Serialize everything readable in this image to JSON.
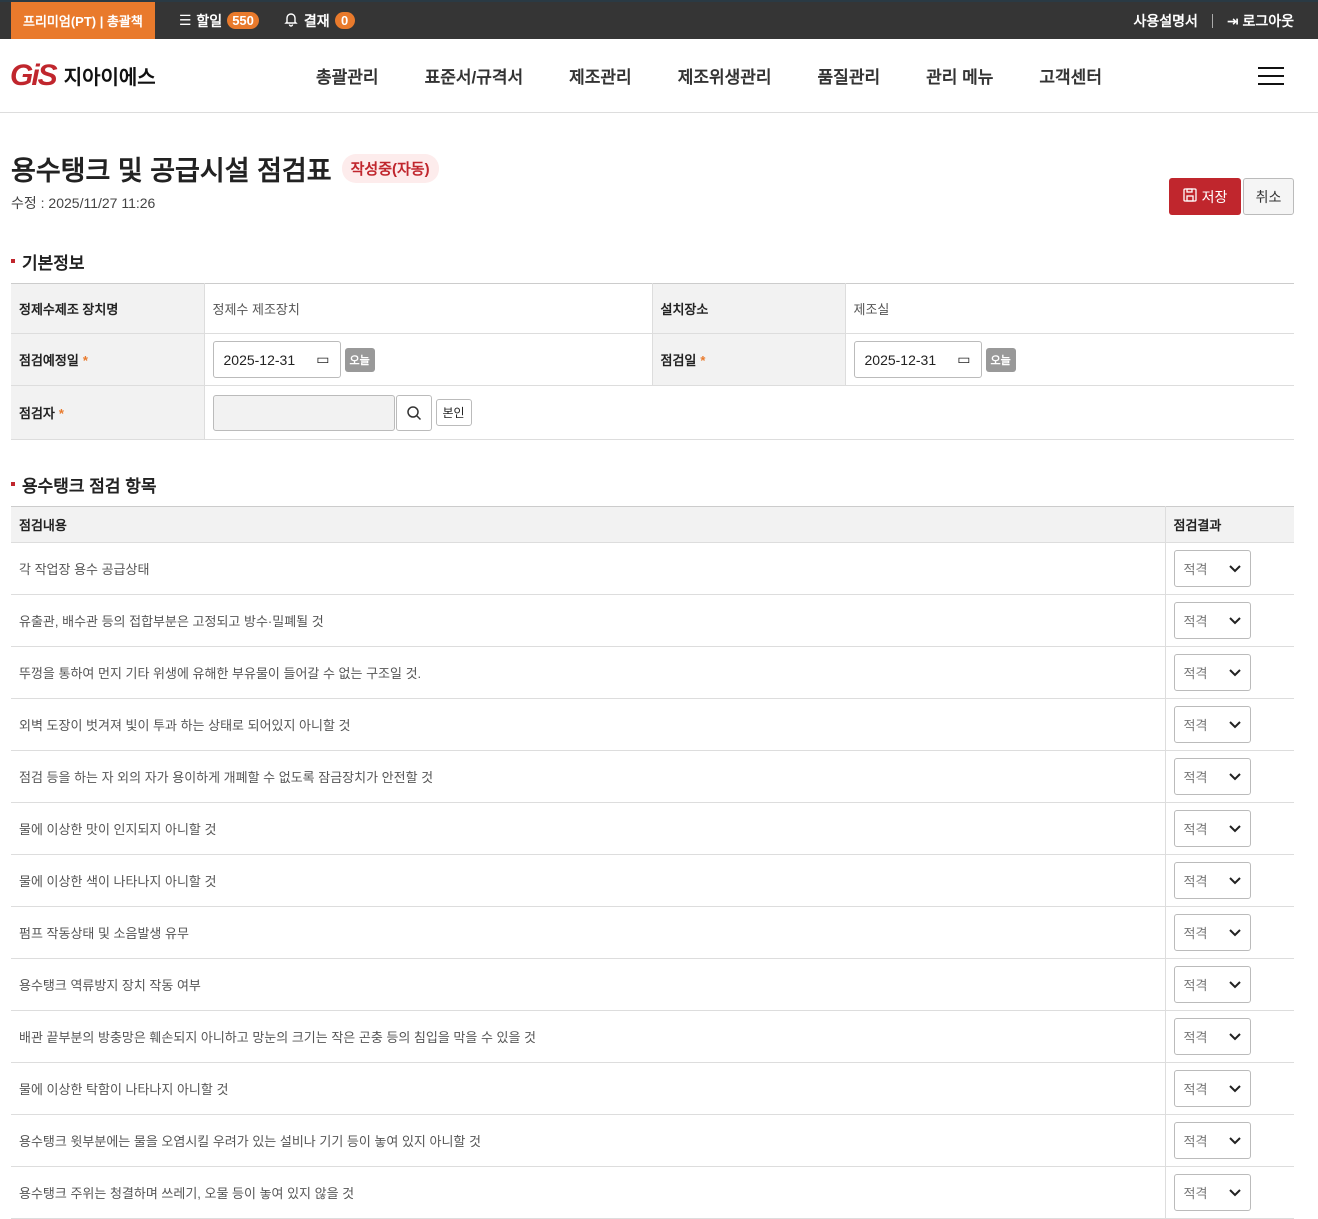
{
  "topbar": {
    "plan": "프리미엄(PT) | 총괄책",
    "todo_label": "할일",
    "todo_count": "550",
    "approval_label": "결재",
    "approval_count": "0",
    "manual": "사용설명서",
    "logout": "로그아웃"
  },
  "header": {
    "logo_mark": "GiS",
    "logo_text": "지아이에스",
    "nav": [
      "총괄관리",
      "표준서/규격서",
      "제조관리",
      "제조위생관리",
      "품질관리",
      "관리 메뉴",
      "고객센터"
    ]
  },
  "page": {
    "title": "용수탱크 및 공급시설 점검표",
    "status": "작성중(자동)",
    "modified": "수정 : 2025/11/27 11:26",
    "save": "저장",
    "cancel": "취소"
  },
  "basic": {
    "section": "기본정보",
    "device_label": "정제수제조 장치명",
    "device_value": "정제수 제조장치",
    "location_label": "설치장소",
    "location_value": "제조실",
    "planned_label": "점검예정일",
    "planned_date": "2025-12-31",
    "date_label": "점검일",
    "date_value": "2025-12-31",
    "today": "오늘",
    "inspector_label": "점검자",
    "inspector_value": "",
    "self": "본인",
    "required": "*"
  },
  "items": {
    "section": "용수탱크 점검 항목",
    "col_content": "점검내용",
    "col_result": "점검결과",
    "rows": [
      {
        "content": "각 작업장 용수 공급상태",
        "result": "적격"
      },
      {
        "content": "유출관, 배수관 등의 접합부분은 고정되고 방수·밀폐될 것",
        "result": "적격"
      },
      {
        "content": "뚜껑을 통하여 먼지 기타 위생에 유해한 부유물이 들어갈 수 없는 구조일 것.",
        "result": "적격"
      },
      {
        "content": "외벽 도장이 벗겨져 빛이 투과 하는 상태로 되어있지 아니할 것",
        "result": "적격"
      },
      {
        "content": "점검 등을 하는 자 외의 자가 용이하게 개폐할 수 없도록 잠금장치가 안전할 것",
        "result": "적격"
      },
      {
        "content": "물에 이상한 맛이 인지되지 아니할 것",
        "result": "적격"
      },
      {
        "content": "물에 이상한 색이 나타나지 아니할 것",
        "result": "적격"
      },
      {
        "content": "펌프 작동상태 및 소음발생 유무",
        "result": "적격"
      },
      {
        "content": "용수탱크 역류방지 장치 작동 여부",
        "result": "적격"
      },
      {
        "content": "배관 끝부분의 방충망은 훼손되지 아니하고 망눈의 크기는 작은 곤충 등의 침입을 막을 수 있을 것",
        "result": "적격"
      },
      {
        "content": "물에 이상한 탁함이 나타나지 아니할 것",
        "result": "적격"
      },
      {
        "content": "용수탱크 윗부분에는 물을 오염시킬 우려가 있는 설비나 기기 등이 놓여 있지 아니할 것",
        "result": "적격"
      },
      {
        "content": "용수탱크 주위는 청결하며 쓰레기, 오물 등이 놓여 있지 않을 것",
        "result": "적격"
      }
    ]
  }
}
